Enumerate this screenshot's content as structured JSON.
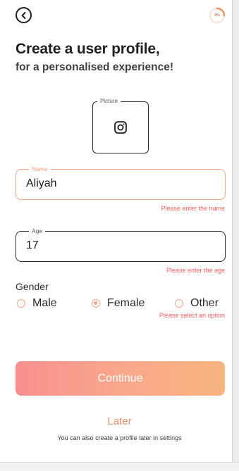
{
  "header": {
    "back_icon": "chevron-left-circle-icon",
    "progress_text": "0%",
    "progress_value": 0
  },
  "title": "Create a user profile,",
  "subtitle": "for a personalised experience!",
  "picture": {
    "label": "Picture",
    "icon": "instagram-camera-icon"
  },
  "name": {
    "label": "Name",
    "value": "Aliyah",
    "error": "Please enter the name"
  },
  "age": {
    "label": "Age",
    "value": "17",
    "error": "Please enter the age"
  },
  "gender": {
    "label": "Gender",
    "options": [
      "Male",
      "Female",
      "Other"
    ],
    "selected": "Female",
    "error": "Please select an option"
  },
  "continue_label": "Continue",
  "later_label": "Later",
  "later_hint": "You can also create a profile later in settings",
  "colors": {
    "accent": "#f4a48b",
    "error": "#f25f5c",
    "gradient_start": "#f8908f",
    "gradient_end": "#f9b47e",
    "text": "#1f1f24"
  }
}
